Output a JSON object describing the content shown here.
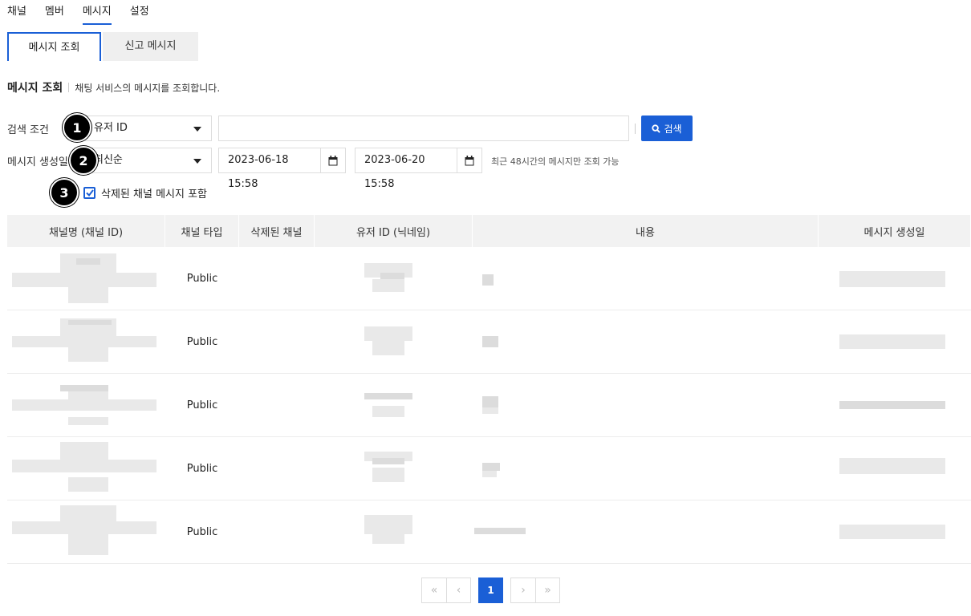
{
  "top_nav": [
    "채널",
    "멤버",
    "메시지",
    "설정"
  ],
  "sub_tabs": [
    "메시지 조회",
    "신고 메시지"
  ],
  "section": {
    "title": "메시지 조회",
    "description": "채팅 서비스의 메시지를 조회합니다."
  },
  "search": {
    "label": "검색 조건",
    "field_select": "유저 ID",
    "keyword_value": "",
    "button_label": "검색"
  },
  "date_filter": {
    "label": "메시지 생성일",
    "sort_select": "최신순",
    "start": "2023-06-18 15:58",
    "end": "2023-06-20 15:58",
    "hint": "최근 48시간의 메시지만 조회 가능"
  },
  "include_deleted": {
    "checked": true,
    "label": "삭제된 채널 메시지 포함"
  },
  "badges": [
    "1",
    "2",
    "3"
  ],
  "table": {
    "columns": [
      "채널명 (채널 ID)",
      "채널 타입",
      "삭제된 채널",
      "유저 ID (닉네임)",
      "내용",
      "메시지 생성일"
    ],
    "rows": [
      {
        "channel_type": "Public",
        "deleted": ""
      },
      {
        "channel_type": "Public",
        "deleted": ""
      },
      {
        "channel_type": "Public",
        "deleted": ""
      },
      {
        "channel_type": "Public",
        "deleted": ""
      },
      {
        "channel_type": "Public",
        "deleted": ""
      }
    ]
  },
  "pagination": {
    "first": "«",
    "prev": "‹",
    "current": "1",
    "next": "›",
    "last": "»"
  },
  "colors": {
    "accent": "#1a5fd6",
    "header_bg": "#f2f2f2"
  }
}
